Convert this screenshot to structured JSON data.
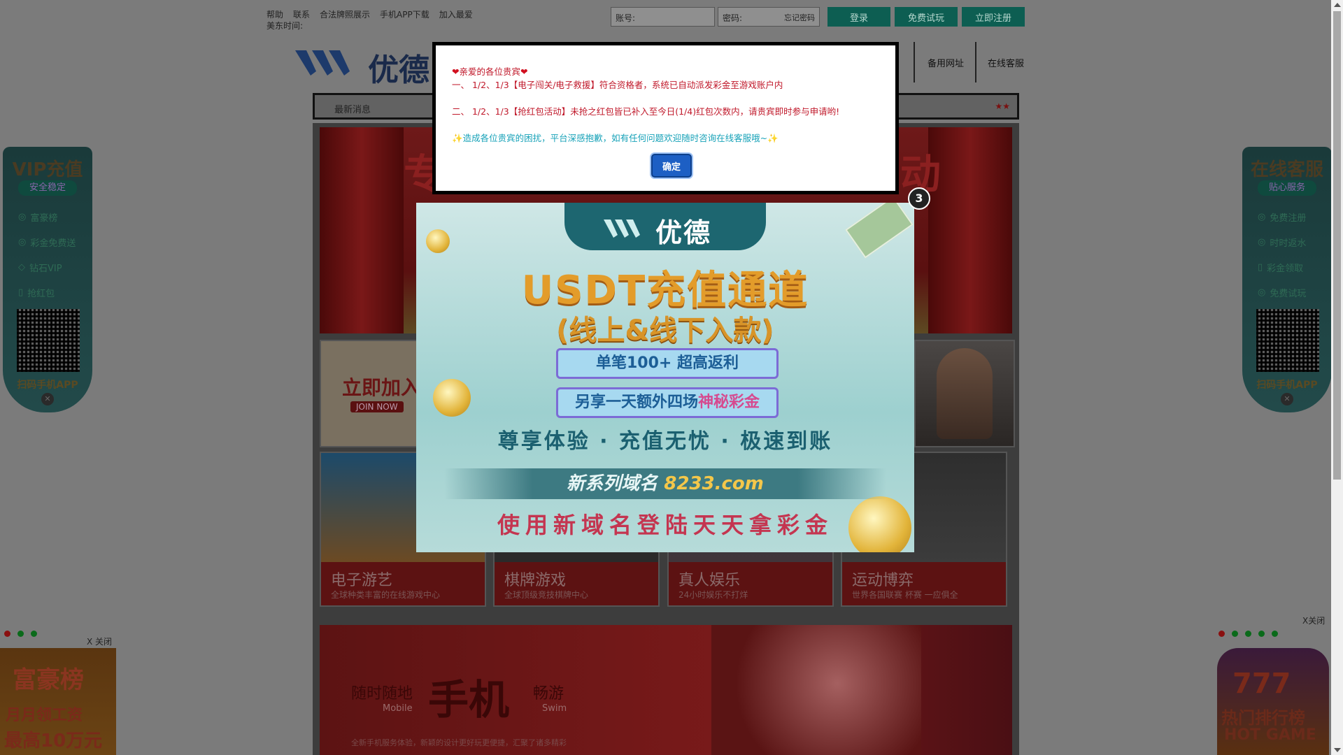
{
  "topbar": {
    "links": [
      "帮助",
      "联系",
      "合法牌照展示",
      "手机APP下载",
      "加入最爱"
    ],
    "clock_label": "美东时间:",
    "account_placeholder": "账号:",
    "password_placeholder": "密码:",
    "forgot_label": "忘记密码",
    "login_label": "登录",
    "trial_label": "免费试玩",
    "register_label": "立即注册"
  },
  "header": {
    "logo_text": "优德",
    "nav": [
      "备用网址",
      "在线客服"
    ]
  },
  "ticker": {
    "label": "最新消息",
    "stars": "★★"
  },
  "banner": {
    "left_text": "专",
    "right_text": "动"
  },
  "promo": {
    "join_label": "立即加入",
    "join_en": "JOIN NOW"
  },
  "tiles": [
    {
      "title": "电子游艺",
      "subtitle": "全球种类丰富的在线游戏中心"
    },
    {
      "title": "棋牌游戏",
      "subtitle": "全球顶级竞技棋牌中心"
    },
    {
      "title": "真人娱乐",
      "subtitle": "24小时娱乐不打烊"
    },
    {
      "title": "运动博弈",
      "subtitle": "世界各国联赛 杯赛 一应俱全"
    }
  ],
  "mobile": {
    "left": "随时随地",
    "left_en": "Mobile",
    "center": "手机",
    "right": "畅游",
    "right_en": "Swim",
    "desc": "全新手机服务体验，新颖的设计更好玩更便捷，汇聚了诸多精彩"
  },
  "side_left": {
    "title": "VIP充值",
    "subtitle": "安全稳定",
    "items": [
      "富豪榜",
      "彩金免费送",
      "钻石VIP",
      "抢红包"
    ],
    "footer": "扫码手机APP"
  },
  "side_right": {
    "title": "在线客服",
    "subtitle": "贴心服务",
    "items": [
      "免费注册",
      "时时返水",
      "彩金领取",
      "免费试玩"
    ],
    "footer": "扫码手机APP"
  },
  "close_label_left": "X 关闭",
  "close_label_right": "X关闭",
  "corner_left": {
    "line1": "富豪榜",
    "line2": "月月领工资",
    "line3": "最高10万元"
  },
  "corner_right": {
    "line1": "777",
    "line2": "热门排行榜",
    "line3": "HOT GAME"
  },
  "ad": {
    "logo": "优德",
    "title": "USDT充值通道",
    "subtitle": "(线上&线下入款)",
    "banner1": "单笔100+ 超高返利",
    "banner2_pre": "另享一天额外四场",
    "banner2_hl": "神秘彩金",
    "line": "尊享体验 · 充值无忧 · 极速到账",
    "domain_pre": "新系列域名",
    "domain": "8233.com",
    "cta": "使用新域名登陆天天拿彩金",
    "countdown": "3"
  },
  "dialog": {
    "greeting": "亲爱的各位贵宾",
    "line1": "一、 1/2、1/3【电子闯关/电子救援】符合资格者，系统已自动派发彩金至游戏账户内",
    "line2": "二、 1/2、1/3【抢红包活动】未抢之红包皆已补入至今日(1/4)红包次数内，请贵宾即时参与申请哟!",
    "line3": "造成各位贵宾的困扰，平台深感抱歉，如有任何问题欢迎随时咨询在线客服哦~",
    "ok_label": "确定"
  },
  "colors": {
    "dialog_red": "#c0182a",
    "dialog_teal": "#17a2b8",
    "ok_blue": "#1d5fc4",
    "overlay_gray": "#7b7b7b"
  }
}
